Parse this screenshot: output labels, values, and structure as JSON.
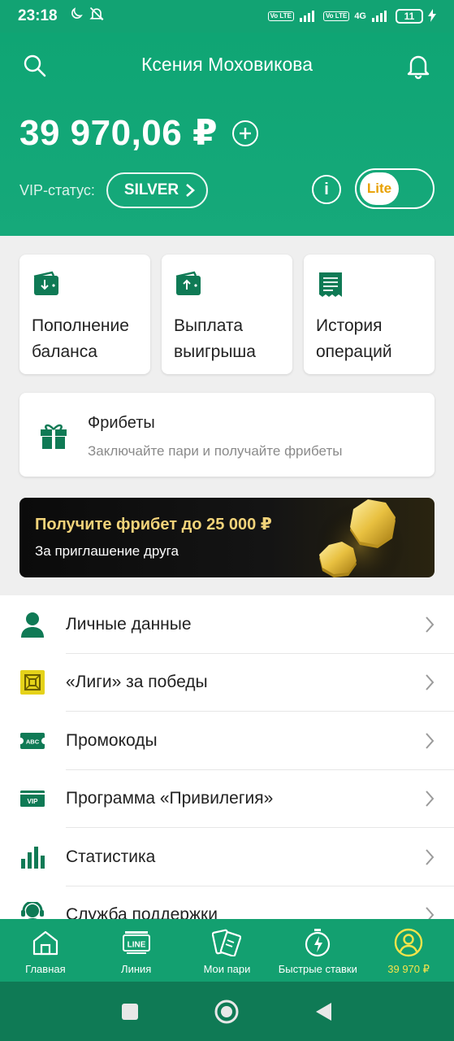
{
  "status_bar": {
    "time": "23:18",
    "network_4g": "4G",
    "volte_1": "Vo LTE",
    "volte_2": "Vo LTE",
    "battery": "11"
  },
  "header": {
    "user_name": "Ксения Моховикова",
    "balance": "39 970,06 ₽",
    "vip_label": "VIP-статус:",
    "vip_status": "SILVER",
    "info_glyph": "i",
    "mode_toggle": "Lite"
  },
  "actions": [
    {
      "label": "Пополнение баланса",
      "icon": "wallet-deposit-icon"
    },
    {
      "label": "Выплата выигрыша",
      "icon": "wallet-withdraw-icon"
    },
    {
      "label": "История операций",
      "icon": "receipt-icon"
    }
  ],
  "freebets": {
    "title": "Фрибеты",
    "subtitle": "Заключайте пари и получайте фрибеты"
  },
  "promo": {
    "title": "Получите фрибет до 25 000 ₽",
    "subtitle": "За приглашение друга"
  },
  "menu": [
    {
      "label": "Личные данные",
      "icon": "person-icon"
    },
    {
      "label": "«Лиги» за победы",
      "icon": "league-icon"
    },
    {
      "label": "Промокоды",
      "icon": "promo-code-icon",
      "icon_text": "ABC"
    },
    {
      "label": "Программа «Привилегия»",
      "icon": "vip-icon",
      "icon_text": "VIP"
    },
    {
      "label": "Статистика",
      "icon": "statistics-icon"
    },
    {
      "label": "Служба поддержки",
      "icon": "support-icon"
    }
  ],
  "bottom_nav": [
    {
      "label": "Главная",
      "icon": "home-icon",
      "active": false
    },
    {
      "label": "Линия",
      "icon": "line-icon",
      "icon_text": "LINE",
      "active": false
    },
    {
      "label": "Мои пари",
      "icon": "tickets-icon",
      "active": false
    },
    {
      "label": "Быстрые ставки",
      "icon": "stopwatch-icon",
      "active": false
    },
    {
      "label": "39 970 ₽",
      "icon": "profile-icon",
      "active": true
    }
  ],
  "colors": {
    "brand_green": "#12a373",
    "accent_yellow": "#f5e44a",
    "lite_orange": "#e8a000",
    "promo_gold": "#f2d37a"
  }
}
